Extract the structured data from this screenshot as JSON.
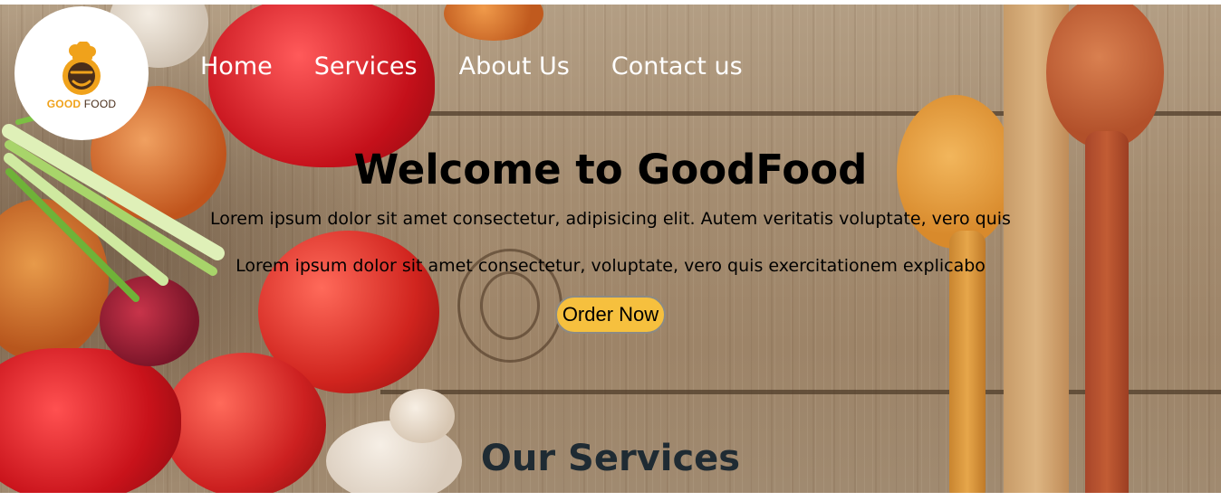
{
  "brand": {
    "logo_good": "GOOD",
    "logo_food": "FOOD"
  },
  "nav": {
    "items": [
      "Home",
      "Services",
      "About Us",
      "Contact us"
    ]
  },
  "hero": {
    "title": "Welcome to GoodFood",
    "line1": "Lorem ipsum dolor sit amet consectetur, adipisicing elit. Autem veritatis voluptate, vero quis",
    "line2": "Lorem ipsum dolor sit amet consectetur, voluptate, vero quis exercitationem explicabo",
    "cta": "Order Now"
  },
  "section": {
    "title": "Our Services"
  },
  "colors": {
    "accent": "#f6c03e",
    "nav_text": "#ffffff",
    "wood": "#a48c70",
    "heading": "#1f2b33"
  },
  "icons": [
    "chef-hat-logo-icon"
  ]
}
